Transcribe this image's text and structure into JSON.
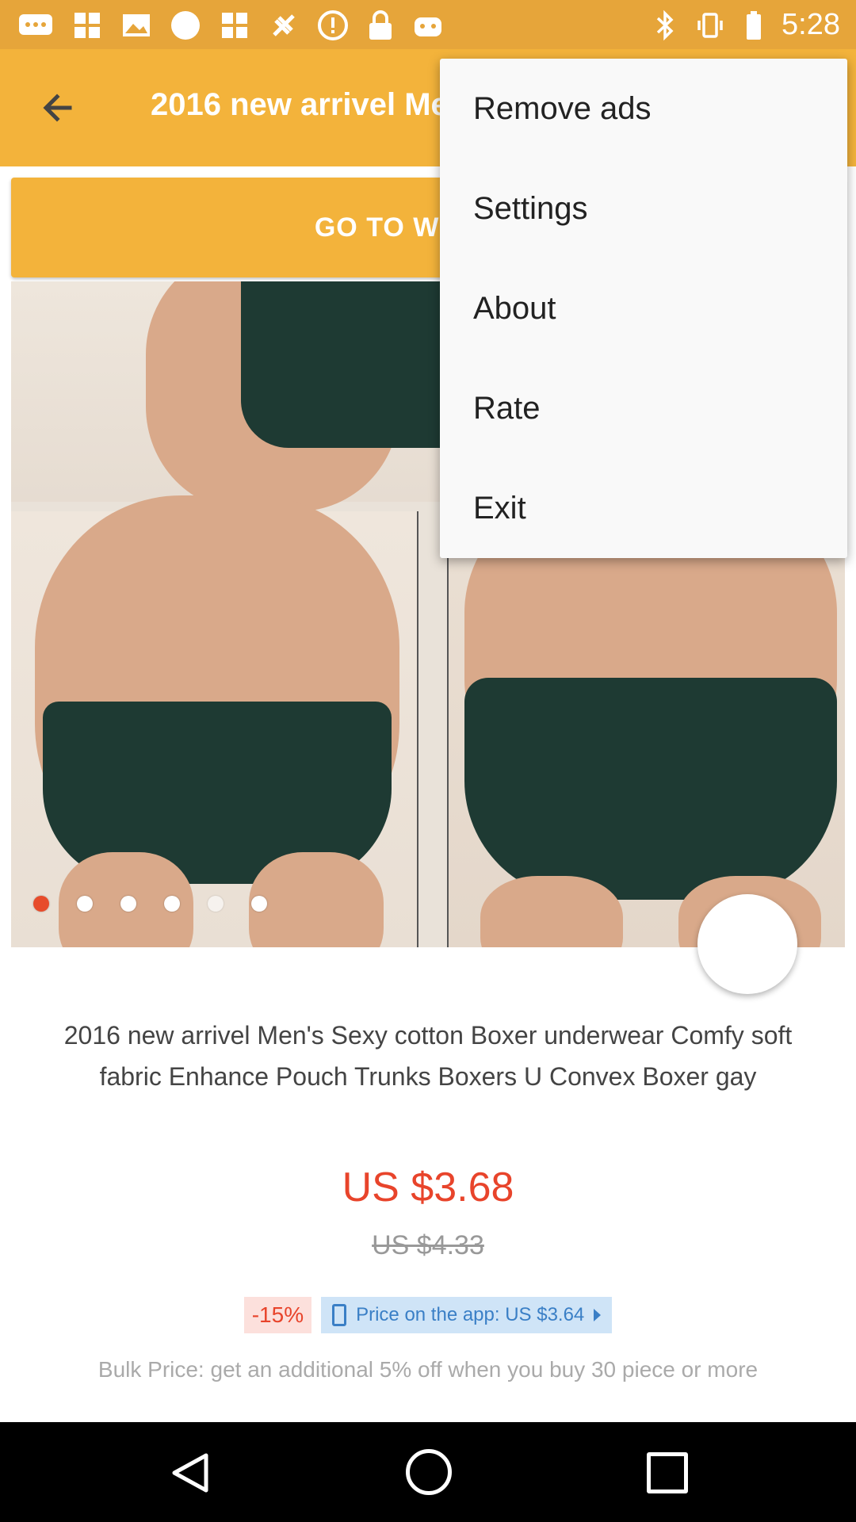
{
  "status_bar": {
    "time": "5:28",
    "icons_left": [
      "messages-icon",
      "pinwheel-icon",
      "photo-icon",
      "circle-icon",
      "pinwheel-icon",
      "satellite-icon",
      "alert-icon",
      "lock-icon",
      "android-icon"
    ],
    "icons_right": [
      "bluetooth-icon",
      "vibrate-icon",
      "battery-icon"
    ]
  },
  "toolbar": {
    "title": "2016 new arrivel Men's Sexy cotton Boxer underwear",
    "back_icon": "arrow-left-icon",
    "color": "#f3b33b"
  },
  "goto_button": {
    "label": "GO TO WEBSITE"
  },
  "carousel": {
    "dot_count": 6,
    "active_index": 0,
    "active_color": "#e74c2b"
  },
  "product": {
    "title": "2016 new arrivel Men's Sexy cotton Boxer underwear Comfy soft fabric Enhance Pouch Trunks Boxers U Convex Boxer gay",
    "price": "US $3.68",
    "old_price": "US $4.33",
    "discount": "-15%",
    "app_price": "Price on the app: US $3.64",
    "bulk_price": "Bulk Price: get an additional 5% off when you buy 30 piece or more"
  },
  "menu": {
    "items": [
      {
        "label": "Remove ads"
      },
      {
        "label": "Settings"
      },
      {
        "label": "About"
      },
      {
        "label": "Rate"
      },
      {
        "label": "Exit"
      }
    ]
  },
  "nav_bar": {
    "icons": [
      "back-triangle-icon",
      "home-circle-icon",
      "recents-square-icon"
    ]
  }
}
